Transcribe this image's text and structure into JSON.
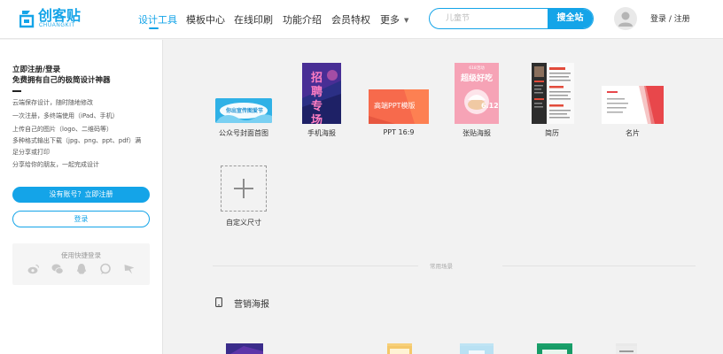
{
  "header": {
    "logo": {
      "name": "创客贴",
      "sub": "CHUANGKIT"
    },
    "nav": [
      {
        "label": "设计工具",
        "active": true
      },
      {
        "label": "模板中心",
        "active": false
      },
      {
        "label": "在线印刷",
        "active": false
      },
      {
        "label": "功能介绍",
        "active": false
      },
      {
        "label": "会员特权",
        "active": false
      },
      {
        "label": "更多",
        "active": false,
        "caret": "▼"
      }
    ],
    "search": {
      "placeholder": "儿童节",
      "button": "搜全站"
    },
    "login_link": "登录 / 注册"
  },
  "left_panel": {
    "title": "立即注册/登录",
    "subtitle": "免费拥有自己的极简设计神器",
    "features": [
      "云端保存设计，随时随地修改",
      "一次注册，多终端使用（iPad、手机）",
      "上传自己的图片（logo、二维码等）",
      "多种格式输出下载（jpg、png、ppt、pdf）满",
      "足分享或打印",
      "分享给你的朋友，一起完成设计"
    ],
    "register_button": "没有账号？立即注册",
    "login_button": "登录",
    "quick_login": {
      "title": "使用快捷登录",
      "icons": [
        "weibo-icon",
        "wechat-icon",
        "qq-icon",
        "chat-icon",
        "dingtalk-icon"
      ]
    }
  },
  "templates": [
    {
      "label": "公众号封面首图",
      "thumb_text": "你出宣传图爱节"
    },
    {
      "label": "手机海报",
      "thumb_text": "招聘专场"
    },
    {
      "label": "PPT 16:9",
      "thumb_text": "高端PPT模版"
    },
    {
      "label": "张贴海报",
      "thumb_text": "超级好吃",
      "thumb_sub": "618活动",
      "thumb_date": "6.12"
    },
    {
      "label": "简历",
      "thumb_text": ""
    },
    {
      "label": "名片",
      "thumb_text": ""
    }
  ],
  "custom_size": {
    "label": "自定义尺寸",
    "icon": "+"
  },
  "section_divider": "常用场景",
  "section": {
    "title": "营销海报"
  },
  "colors": {
    "accent": "#14a4e8",
    "background": "#f2f2f2"
  }
}
